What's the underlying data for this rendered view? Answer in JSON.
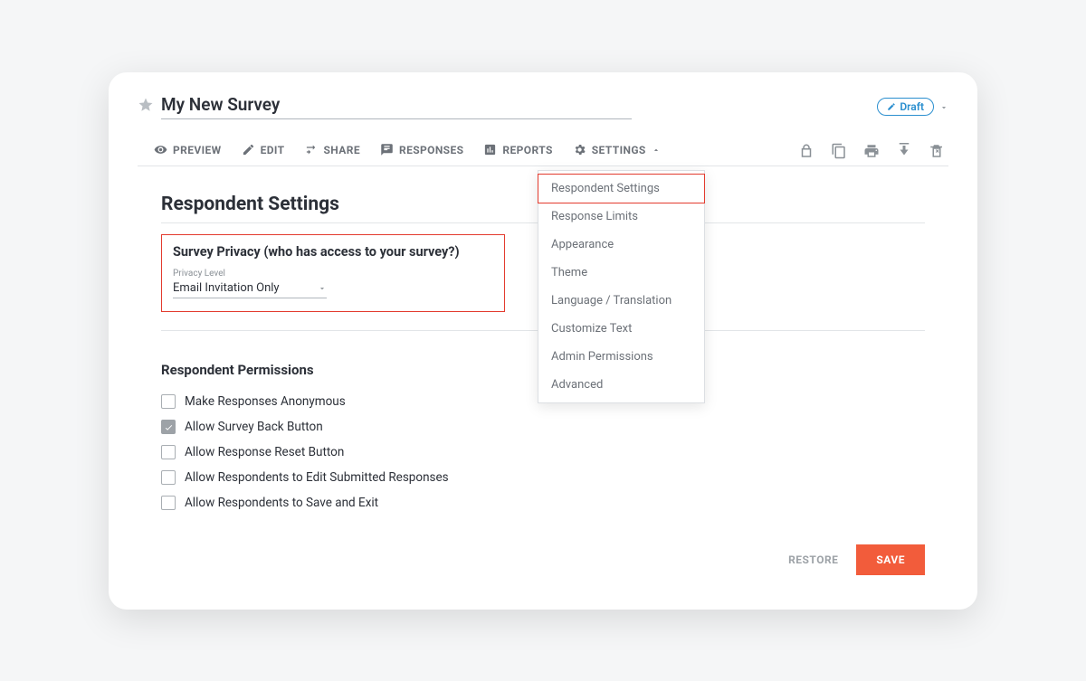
{
  "survey_title": "My New Survey",
  "status": {
    "label": "Draft"
  },
  "toolbar": {
    "preview": "PREVIEW",
    "edit": "EDIT",
    "share": "SHARE",
    "responses": "RESPONSES",
    "reports": "REPORTS",
    "settings": "SETTINGS"
  },
  "settings_menu": [
    "Respondent Settings",
    "Response Limits",
    "Appearance",
    "Theme",
    "Language / Translation",
    "Customize Text",
    "Admin Permissions",
    "Advanced"
  ],
  "page": {
    "heading": "Respondent Settings",
    "privacy_section_title": "Survey Privacy (who has access to your survey?)",
    "privacy_field_label": "Privacy Level",
    "privacy_value": "Email Invitation Only",
    "permissions_heading": "Respondent Permissions",
    "permissions": [
      {
        "label": "Make Responses Anonymous",
        "checked": false
      },
      {
        "label": "Allow Survey Back Button",
        "checked": true
      },
      {
        "label": "Allow Response Reset Button",
        "checked": false
      },
      {
        "label": "Allow Respondents to Edit Submitted Responses",
        "checked": false
      },
      {
        "label": "Allow Respondents to Save and Exit",
        "checked": false
      }
    ]
  },
  "footer": {
    "restore": "RESTORE",
    "save": "SAVE"
  }
}
